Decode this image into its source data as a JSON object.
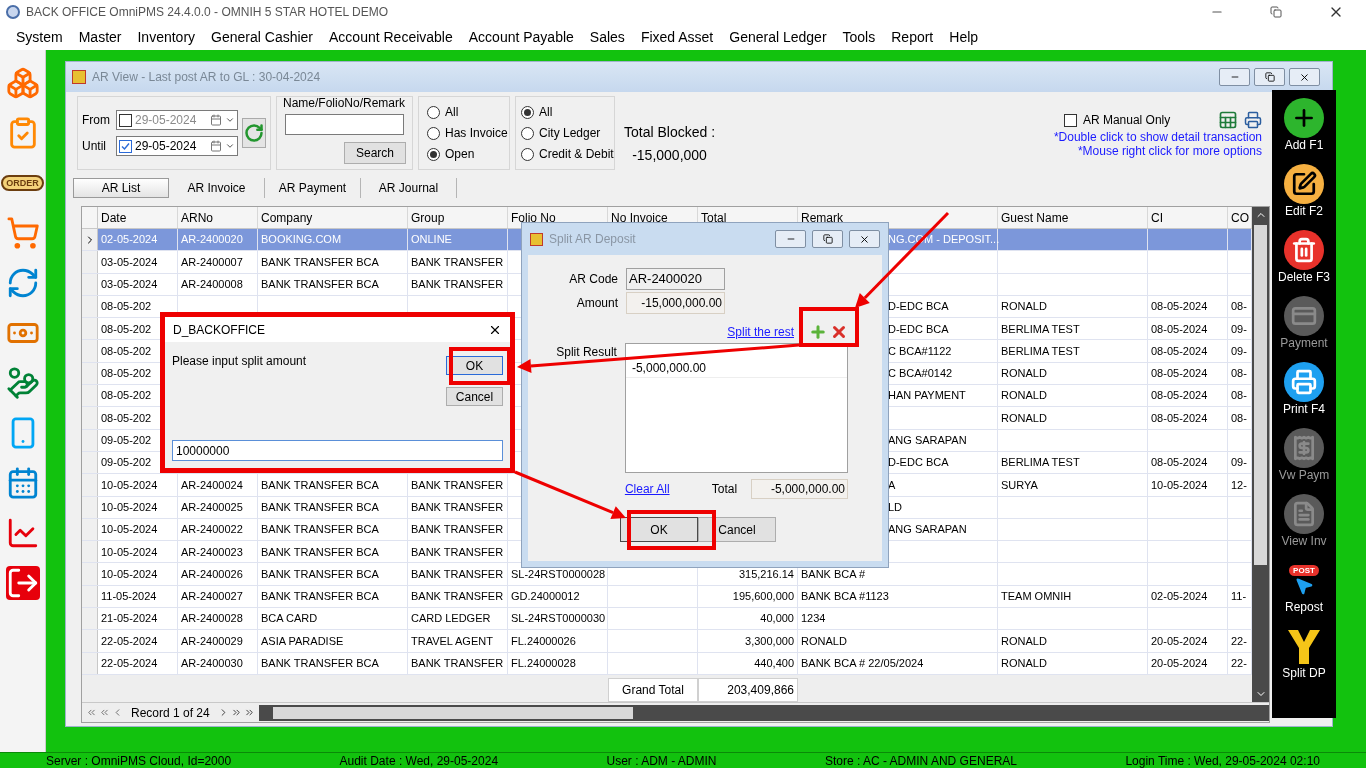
{
  "app_title": "BACK OFFICE OmniPMS 24.4.0.0 - OMNIH 5 STAR HOTEL DEMO",
  "menu": [
    "System",
    "Master",
    "Inventory",
    "General Cashier",
    "Account Receivable",
    "Account Payable",
    "Sales",
    "Fixed Asset",
    "General Ledger",
    "Tools",
    "Report",
    "Help"
  ],
  "left_toolbar": [
    {
      "kind": "boxes"
    },
    {
      "kind": "clipboard"
    },
    {
      "kind": "order",
      "label": "ORDER"
    },
    {
      "kind": "cart"
    },
    {
      "kind": "refresh"
    },
    {
      "kind": "money"
    },
    {
      "kind": "hand"
    },
    {
      "kind": "phone"
    },
    {
      "kind": "calendar"
    },
    {
      "kind": "chart"
    },
    {
      "kind": "exit"
    }
  ],
  "ar_window": {
    "title": "AR View - Last post AR to GL : 30-04-2024",
    "filters": {
      "from": {
        "label": "From",
        "checked": false,
        "value": "29-05-2024"
      },
      "until": {
        "label": "Until",
        "checked": true,
        "value": "29-05-2024"
      },
      "search_label": "Name/FolioNo/Remark",
      "search_button": "Search",
      "invoice_radios": [
        {
          "label": "All",
          "selected": false
        },
        {
          "label": "Has Invoice",
          "selected": false
        },
        {
          "label": "Open",
          "selected": true
        }
      ],
      "ledger_radios": [
        {
          "label": "All",
          "selected": true
        },
        {
          "label": "City Ledger",
          "selected": false
        },
        {
          "label": "Credit & Debit",
          "selected": false
        }
      ],
      "total_blocked_label": "Total Blocked :",
      "total_blocked_value": "-15,000,000",
      "manual_only": {
        "label": "AR Manual Only",
        "checked": false
      },
      "hints": [
        "*Double click to show detail transaction",
        "*Mouse right click for more options"
      ]
    },
    "tabs": [
      {
        "label": "AR List",
        "selected": true
      },
      {
        "label": "AR Invoice",
        "selected": false
      },
      {
        "label": "AR Payment",
        "selected": false
      },
      {
        "label": "AR Journal",
        "selected": false
      }
    ],
    "table": {
      "columns": [
        "Date",
        "ARNo",
        "Company",
        "Group",
        "Folio No",
        "No Invoice",
        "Total",
        "Remark",
        "Guest Name",
        "CI",
        "CO"
      ],
      "rows": [
        {
          "selected": true,
          "cells": [
            "02-05-2024",
            "AR-2400020",
            "BOOKING.COM",
            "ONLINE",
            null,
            null,
            null,
            "NG.COM - DEPOSIT...",
            null,
            null,
            null
          ]
        },
        {
          "selected": false,
          "cells": [
            "03-05-2024",
            "AR-2400007",
            "BANK TRANSFER BCA",
            "BANK TRANSFER",
            null,
            null,
            null,
            null,
            null,
            null,
            null
          ]
        },
        {
          "selected": false,
          "cells": [
            "03-05-2024",
            "AR-2400008",
            "BANK TRANSFER BCA",
            "BANK TRANSFER",
            null,
            null,
            null,
            null,
            null,
            null,
            null
          ]
        },
        {
          "selected": false,
          "cells": [
            "08-05-202",
            null,
            null,
            null,
            null,
            null,
            null,
            "D-EDC BCA",
            "RONALD",
            "08-05-2024",
            "08-"
          ]
        },
        {
          "selected": false,
          "cells": [
            "08-05-202",
            null,
            null,
            null,
            null,
            null,
            null,
            "D-EDC BCA",
            "BERLIMA TEST",
            "08-05-2024",
            "09-"
          ]
        },
        {
          "selected": false,
          "cells": [
            "08-05-202",
            null,
            null,
            null,
            null,
            null,
            null,
            "C BCA#1122",
            "BERLIMA TEST",
            "08-05-2024",
            "09-"
          ]
        },
        {
          "selected": false,
          "cells": [
            "08-05-202",
            null,
            null,
            null,
            null,
            null,
            null,
            "C BCA#0142",
            "RONALD",
            "08-05-2024",
            "08-"
          ]
        },
        {
          "selected": false,
          "cells": [
            "08-05-202",
            null,
            null,
            null,
            null,
            null,
            null,
            "HAN PAYMENT",
            "RONALD",
            "08-05-2024",
            "08-"
          ]
        },
        {
          "selected": false,
          "cells": [
            "08-05-202",
            null,
            null,
            null,
            null,
            null,
            null,
            null,
            "RONALD",
            "08-05-2024",
            "08-"
          ]
        },
        {
          "selected": false,
          "cells": [
            "09-05-202",
            null,
            null,
            null,
            null,
            null,
            null,
            "ANG SARAPAN",
            null,
            null,
            null
          ]
        },
        {
          "selected": false,
          "cells": [
            "09-05-202",
            null,
            null,
            null,
            null,
            null,
            null,
            "D-EDC BCA",
            "BERLIMA TEST",
            "08-05-2024",
            "09-"
          ]
        },
        {
          "selected": false,
          "cells": [
            "10-05-2024",
            "AR-2400024",
            "BANK TRANSFER BCA",
            "BANK TRANSFER",
            null,
            null,
            null,
            "A",
            "SURYA",
            "10-05-2024",
            "12-"
          ]
        },
        {
          "selected": false,
          "cells": [
            "10-05-2024",
            "AR-2400025",
            "BANK TRANSFER BCA",
            "BANK TRANSFER",
            null,
            null,
            null,
            "LD",
            null,
            null,
            null
          ]
        },
        {
          "selected": false,
          "cells": [
            "10-05-2024",
            "AR-2400022",
            "BANK TRANSFER BCA",
            "BANK TRANSFER",
            null,
            null,
            null,
            "ANG SARAPAN",
            null,
            null,
            null
          ]
        },
        {
          "selected": false,
          "cells": [
            "10-05-2024",
            "AR-2400023",
            "BANK TRANSFER BCA",
            "BANK TRANSFER",
            null,
            null,
            null,
            null,
            null,
            null,
            null
          ]
        },
        {
          "selected": false,
          "cells": [
            "10-05-2024",
            "AR-2400026",
            "BANK TRANSFER BCA",
            "BANK TRANSFER",
            "SL-24RST0000028",
            null,
            "315,216.14",
            "BANK BCA #",
            null,
            null,
            null
          ]
        },
        {
          "selected": false,
          "cells": [
            "11-05-2024",
            "AR-2400027",
            "BANK TRANSFER BCA",
            "BANK TRANSFER",
            "GD.24000012",
            null,
            "195,600,000",
            "BANK BCA #1123",
            "TEAM OMNIH",
            "02-05-2024",
            "11-"
          ]
        },
        {
          "selected": false,
          "cells": [
            "21-05-2024",
            "AR-2400028",
            "BCA CARD",
            "CARD LEDGER",
            "SL-24RST0000030",
            null,
            "40,000",
            "1234",
            null,
            null,
            null
          ]
        },
        {
          "selected": false,
          "cells": [
            "22-05-2024",
            "AR-2400029",
            "ASIA PARADISE",
            "TRAVEL AGENT",
            "FL.24000026",
            null,
            "3,300,000",
            "RONALD",
            "RONALD",
            "20-05-2024",
            "22-"
          ]
        },
        {
          "selected": false,
          "cells": [
            "22-05-2024",
            "AR-2400030",
            "BANK TRANSFER BCA",
            "BANK TRANSFER",
            "FL.24000028",
            null,
            "440,400",
            "BANK BCA # 22/05/2024",
            "RONALD",
            "20-05-2024",
            "22-"
          ]
        }
      ],
      "grand_total_label": "Grand Total",
      "grand_total_value": "203,409,866"
    },
    "record_nav": "Record 1 of 24"
  },
  "right_toolbar": [
    {
      "kind": "add",
      "label": "Add F1",
      "disabled": false
    },
    {
      "kind": "edit",
      "label": "Edit F2",
      "disabled": false
    },
    {
      "kind": "delete",
      "label": "Delete F3",
      "disabled": false
    },
    {
      "kind": "payment",
      "label": "Payment",
      "disabled": true
    },
    {
      "kind": "print",
      "label": "Print F4",
      "disabled": false
    },
    {
      "kind": "payment_view",
      "label": "Vw Paym",
      "disabled": true
    },
    {
      "kind": "invoice_view",
      "label": "View Inv",
      "disabled": true
    },
    {
      "kind": "repost",
      "label": "Repost",
      "badge": "POST",
      "disabled": false
    },
    {
      "kind": "split",
      "label": "Split DP",
      "disabled": false
    }
  ],
  "split_dialog": {
    "title": "Split AR Deposit",
    "ar_code_label": "AR Code",
    "ar_code": "AR-2400020",
    "amount_label": "Amount",
    "amount": "-15,000,000.00",
    "split_rest_link": "Split the rest",
    "split_result_label": "Split Result",
    "split_results": [
      "-5,000,000.00"
    ],
    "clear_all_link": "Clear All",
    "total_label": "Total",
    "total": "-5,000,000.00",
    "buttons": [
      "OK",
      "Cancel"
    ]
  },
  "input_dialog": {
    "title": "D_BACKOFFICE",
    "prompt": "Please input split amount",
    "value": "10000000",
    "buttons": [
      "OK",
      "Cancel"
    ]
  },
  "status_bar": [
    "Server : OmniPMS Cloud, Id=2000",
    "Audit Date : Wed, 29-05-2024",
    "User : ADM - ADMIN",
    "Store : AC - ADMIN AND GENERAL",
    "Login Time : Wed, 29-05-2024 02:10"
  ]
}
